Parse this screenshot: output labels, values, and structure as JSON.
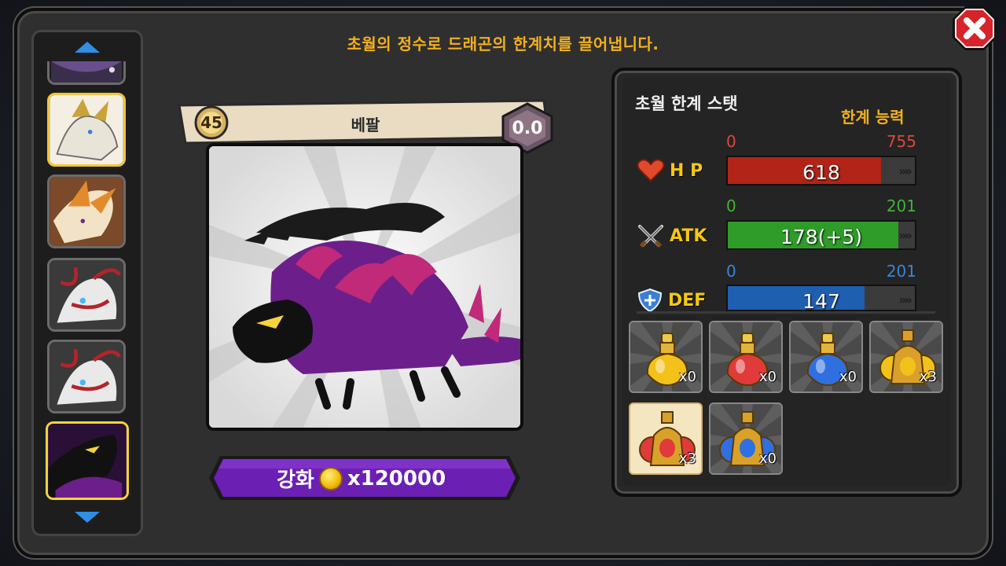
{
  "instruction": "초월의 정수로 드래곤의 한계치를 끌어냅니다.",
  "dragon": {
    "name": "베팔",
    "level": "45",
    "score": "0.0"
  },
  "upgrade": {
    "label": "강화",
    "cost": "x120000",
    "currency_icon": "gold-coin-icon"
  },
  "stats_panel": {
    "title": "초월 한계 스탯",
    "subtitle": "한계 능력",
    "stats": [
      {
        "key": "hp",
        "label": "H P",
        "icon": "heart-icon",
        "min": "0",
        "max": "755",
        "value": "618",
        "current": 618,
        "max_num": 755,
        "fill_color": "#b22418",
        "range_color": "#d9493a"
      },
      {
        "key": "atk",
        "label": "ATK",
        "icon": "crossed-swords-icon",
        "min": "0",
        "max": "201",
        "value": "178(+5)",
        "current": 183,
        "max_num": 201,
        "fill_color": "#2f9c2a",
        "range_color": "#3fb33a"
      },
      {
        "key": "def",
        "label": "DEF",
        "icon": "shield-icon",
        "min": "0",
        "max": "201",
        "value": "147",
        "current": 147,
        "max_num": 201,
        "fill_color": "#1f5fb0",
        "range_color": "#3a85d6"
      }
    ]
  },
  "items": [
    {
      "name": "gold-essence",
      "count": "x0",
      "color": "#f2c21b"
    },
    {
      "name": "red-essence",
      "count": "x0",
      "color": "#e03a3a"
    },
    {
      "name": "blue-essence",
      "count": "x0",
      "color": "#2f6fe0"
    },
    {
      "name": "large-gold-essence",
      "count": "x3",
      "color": "#f2c21b"
    },
    {
      "name": "large-red-essence",
      "count": "x3",
      "color": "#e03a3a"
    },
    {
      "name": "large-blue-essence",
      "count": "x0",
      "color": "#2f6fe0"
    }
  ],
  "roster": {
    "slots": [
      {
        "name": "partial-dragon",
        "colors": [
          "#6a4e8c",
          "#3a2f4a"
        ]
      },
      {
        "name": "white-gold-dragon",
        "colors": [
          "#e8e4d8",
          "#c9a23a"
        ]
      },
      {
        "name": "orange-dragon",
        "colors": [
          "#e38a2c",
          "#f3e3c6"
        ]
      },
      {
        "name": "white-red-dragon",
        "colors": [
          "#e9e9e9",
          "#b3242a"
        ]
      },
      {
        "name": "white-red-dragon-2",
        "colors": [
          "#e9e9e9",
          "#b3242a"
        ]
      },
      {
        "name": "purple-dragon",
        "colors": [
          "#6c1f8a",
          "#111111"
        ]
      }
    ]
  },
  "colors": {
    "accent": "#f2b01e",
    "upgrade_button": "#6b1fb3",
    "close_button": "#d8232a"
  }
}
